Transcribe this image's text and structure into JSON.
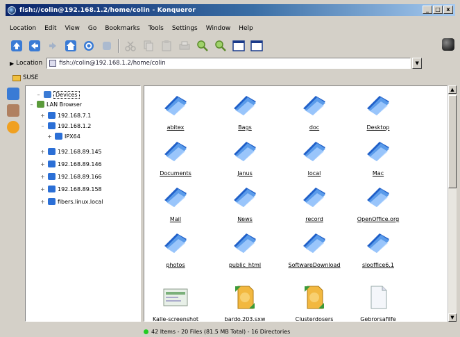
{
  "window": {
    "title": "fish://colin@192.168.1.2/home/colin - Konqueror"
  },
  "menu": [
    "Location",
    "Edit",
    "View",
    "Go",
    "Bookmarks",
    "Tools",
    "Settings",
    "Window",
    "Help"
  ],
  "location": {
    "label": "Location",
    "value": "fish://colin@192.168.1.2/home/colin"
  },
  "bookmark_bar": {
    "item": "SUSE"
  },
  "tree": [
    {
      "label": "Devices",
      "selected": true
    },
    {
      "label": "LAN Browser"
    },
    {
      "label": "192.168.7.1"
    },
    {
      "label": "192.168.1.2"
    },
    {
      "label": "IPX64"
    },
    {
      "label": "192.168.89.145"
    },
    {
      "label": "192.168.89.146"
    },
    {
      "label": "192.168.89.166"
    },
    {
      "label": "192.168.89.158"
    },
    {
      "label": "fibers.linux.local"
    }
  ],
  "files": [
    {
      "name": "abitex",
      "type": "folder"
    },
    {
      "name": "Bags",
      "type": "folder"
    },
    {
      "name": "doc",
      "type": "folder"
    },
    {
      "name": "Desktop",
      "type": "folder"
    },
    {
      "name": "Documents",
      "type": "folder"
    },
    {
      "name": "Janus",
      "type": "folder"
    },
    {
      "name": "local",
      "type": "folder"
    },
    {
      "name": "Mac",
      "type": "folder"
    },
    {
      "name": "Mail",
      "type": "folder"
    },
    {
      "name": "News",
      "type": "folder"
    },
    {
      "name": "record",
      "type": "folder"
    },
    {
      "name": "OpenOffice.org",
      "type": "folder"
    },
    {
      "name": "photos",
      "type": "folder"
    },
    {
      "name": "public_html",
      "type": "folder"
    },
    {
      "name": "SoftwareDownload",
      "type": "folder"
    },
    {
      "name": "slooffice6.1",
      "type": "folder"
    },
    {
      "name": "Kalle-screenshot",
      "type": "image"
    },
    {
      "name": "bardo.203.sxw",
      "type": "document"
    },
    {
      "name": "Clusterdosers",
      "type": "document"
    },
    {
      "name": "Gebrorsafilfe",
      "type": "text"
    }
  ],
  "status": {
    "text": "42 Items - 20 Files (81.5 MB Total) - 16 Directories"
  },
  "colors": {
    "title_start": "#0a246a",
    "title_end": "#a6caf0",
    "folder_blue": "#2b6fd6"
  }
}
